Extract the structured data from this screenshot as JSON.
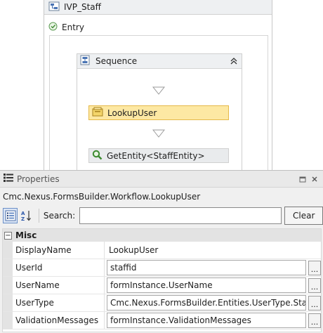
{
  "designer": {
    "workflow_title": "IVP_Staff",
    "entry_label": "Entry",
    "sequence_title": "Sequence",
    "activities": [
      {
        "label": "LookupUser",
        "selected": true
      },
      {
        "label": "GetEntity<StaffEntity>",
        "selected": false
      }
    ]
  },
  "properties": {
    "panel_title": "Properties",
    "selected_type": "Cmc.Nexus.FormsBuilder.Workflow.LookupUser",
    "search_label": "Search:",
    "search_value": "",
    "clear_label": "Clear",
    "category": "Misc",
    "rows": [
      {
        "name": "DisplayName",
        "value": "LookupUser"
      },
      {
        "name": "UserId",
        "value": "staffid",
        "ellipsis": "..."
      },
      {
        "name": "UserName",
        "value": "formInstance.UserName",
        "ellipsis": "..."
      },
      {
        "name": "UserType",
        "value": "Cmc.Nexus.FormsBuilder.Entities.UserType.Staff",
        "ellipsis": "..."
      },
      {
        "name": "ValidationMessages",
        "value": "formInstance.ValidationMessages",
        "ellipsis": "..."
      }
    ]
  },
  "colors": {
    "selected_activity_fill": "#fde8a3",
    "selected_activity_border": "#e5b94a",
    "header_fill": "#eef0f2"
  },
  "icons": [
    "workflow-icon",
    "entry-icon",
    "sequence-icon",
    "collapse-icon",
    "drop-arrow-icon",
    "lookup-icon",
    "search-icon",
    "properties-icon",
    "categorized-icon",
    "alphabetical-icon",
    "restore-icon",
    "close-icon"
  ]
}
